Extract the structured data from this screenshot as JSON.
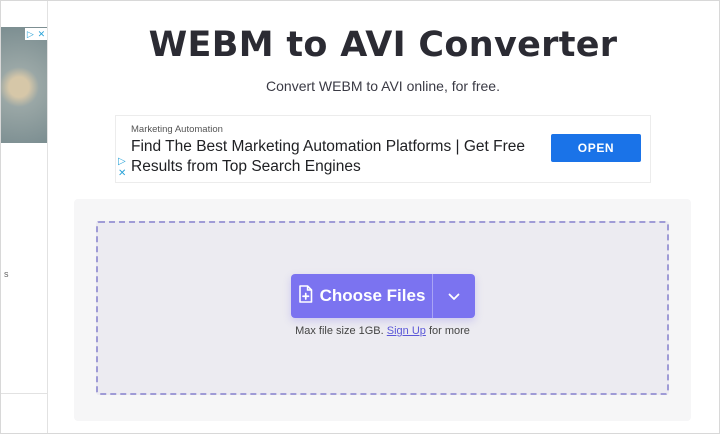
{
  "header": {
    "title": "WEBM to AVI Converter",
    "subtitle": "Convert WEBM to AVI online, for free."
  },
  "left_ad": {
    "choices_icons": [
      "▷",
      "✕"
    ],
    "glyph": "s"
  },
  "ad": {
    "kicker": "Marketing Automation",
    "headline": "Find The Best Marketing Automation Platforms | Get Free Results from Top Search Engines",
    "button_label": "OPEN",
    "choices_icons": [
      "▷",
      "✕"
    ]
  },
  "upload": {
    "choose_label": "Choose Files",
    "icon": "file-plus-icon",
    "dropdown_icon": "chevron-down-icon",
    "limit_prefix": "Max file size 1GB.",
    "signup_label": "Sign Up",
    "limit_suffix": "for more"
  },
  "colors": {
    "accent": "#7b73f0",
    "ad_button": "#1a73e8",
    "dropzone_border": "#9f9bd6",
    "dropzone_bg": "#ecebf1"
  }
}
